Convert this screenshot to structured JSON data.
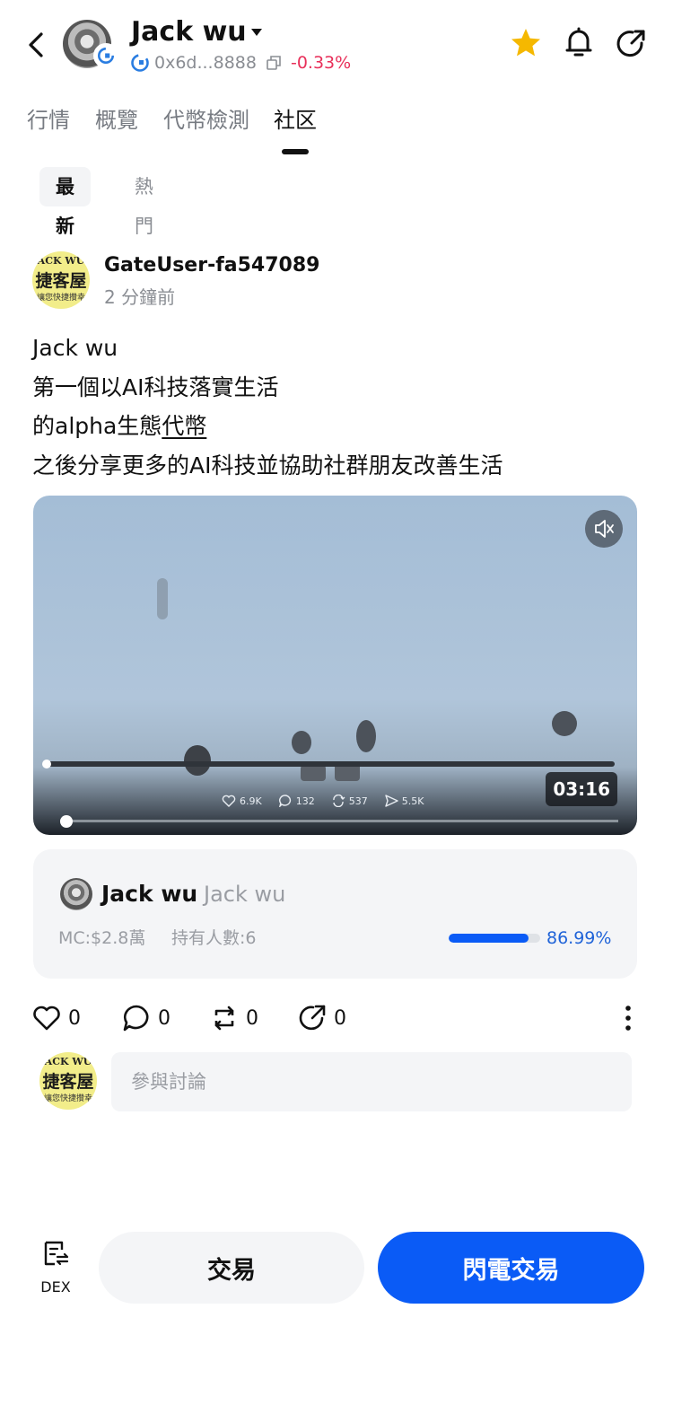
{
  "header": {
    "token_name": "Jack wu",
    "address": "0x6d...8888",
    "change": "-0.33%",
    "colors": {
      "change_negative": "#e8305a",
      "star": "#f5b800"
    }
  },
  "tabs": [
    {
      "label": "行情"
    },
    {
      "label": "概覽"
    },
    {
      "label": "代幣檢測"
    },
    {
      "label": "社区",
      "active": true
    }
  ],
  "subtabs": [
    {
      "label": "最新",
      "active": true
    },
    {
      "label": "熱門"
    }
  ],
  "post": {
    "avatar_text": {
      "line1": "ACK WU",
      "line2": "捷客屋",
      "line3": "讓您快捷攢幸"
    },
    "username": "GateUser-fa547089",
    "time": "2 分鐘前",
    "lines": [
      "Jack wu",
      "第一個以AI科技落實生活",
      "的alpha生態",
      "代幣",
      "之後分享更多的AI科技並協助社群朋友改善生活"
    ],
    "video": {
      "duration": "03:16",
      "stats": {
        "likes": "6.9K",
        "comments": "132",
        "reposts": "537",
        "shares": "5.5K"
      }
    }
  },
  "token_card": {
    "name": "Jack wu",
    "symbol": "Jack wu",
    "market_cap": "MC:$2.8萬",
    "holders": "持有人數:6",
    "progress_pct": "86.99%",
    "progress_value": 0.8699,
    "colors": {
      "progress": "#0a5bf6"
    }
  },
  "actions": {
    "likes": "0",
    "comments": "0",
    "reposts": "0",
    "shares": "0"
  },
  "comment": {
    "placeholder": "參與討論"
  },
  "bottom": {
    "dex_label": "DEX",
    "trade_label": "交易",
    "flash_label": "閃電交易",
    "colors": {
      "primary": "#0a5bf6"
    }
  }
}
